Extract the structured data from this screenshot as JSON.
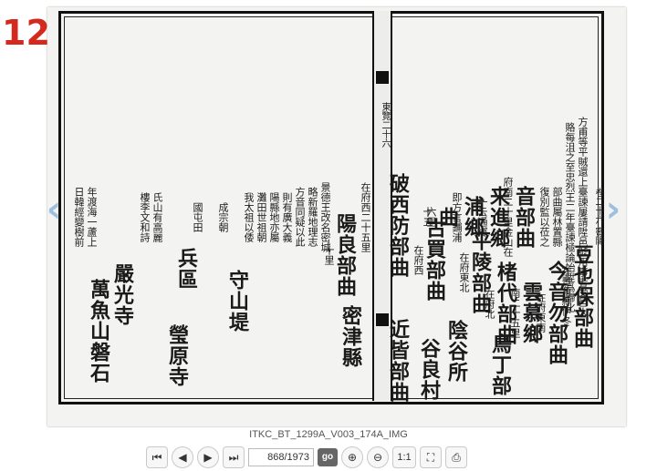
{
  "page_badge": "12",
  "caption": "ITKC_BT_1299A_V003_174A_IMG",
  "pager": {
    "value": "868/1973",
    "go_label": "go",
    "ratio_label": "1:1"
  },
  "icons": [
    "first-page-icon",
    "prev-page-icon",
    "next-page-icon",
    "last-page-icon",
    "zoom-in-icon",
    "zoom-out-icon",
    "fit-page-icon",
    "print-icon"
  ],
  "document": {
    "header_right": "卷二十六 密陽",
    "right_page": [
      "方甫等平賊還上臺諫屢請陞邑號用事者受邑人",
      "賂每沮之至忠烈王二年臺諫極論始陞爲歸化",
      "部曲屬林置縣",
      "復別監以莅之",
      "音部曲",
      "府南二十里金山在",
      "来進鄉",
      "一云通鄉",
      "浦鄉",
      "即方言鋪浦",
      "曲",
      "六里",
      "十五",
      "豆也保部曲",
      "在豐角縣伊冬",
      "今音勿部曲",
      "在府東南",
      "雲慕鄉",
      "南二十五里",
      "楮代部曲",
      "在府北",
      "平陵部曲",
      "在府東北",
      "古買部曲",
      "在府西",
      "鳥丁部",
      "陰谷所",
      "谷良村"
    ],
    "left_page": [
      "在府西二十五里",
      "陽良部曲",
      "十里",
      "密津縣",
      "破西防部曲",
      "近皆部曲",
      "景德王改名密城",
      "略新羅地理志",
      "方音同疑以此",
      "則有廣大義",
      "陽縣地亦屬",
      "灘田世祖朝",
      "我太祖以倭",
      "成宗朝",
      "國屯田",
      "兵區",
      "守山堤",
      "瑩原寺",
      "嚴光寺",
      "萬魚山磐石",
      "日韓經變樹前",
      "年渡海一蘆上",
      "樓李文和詩",
      "氏山有高麗"
    ],
    "pillar_text": "東覽二十六"
  }
}
